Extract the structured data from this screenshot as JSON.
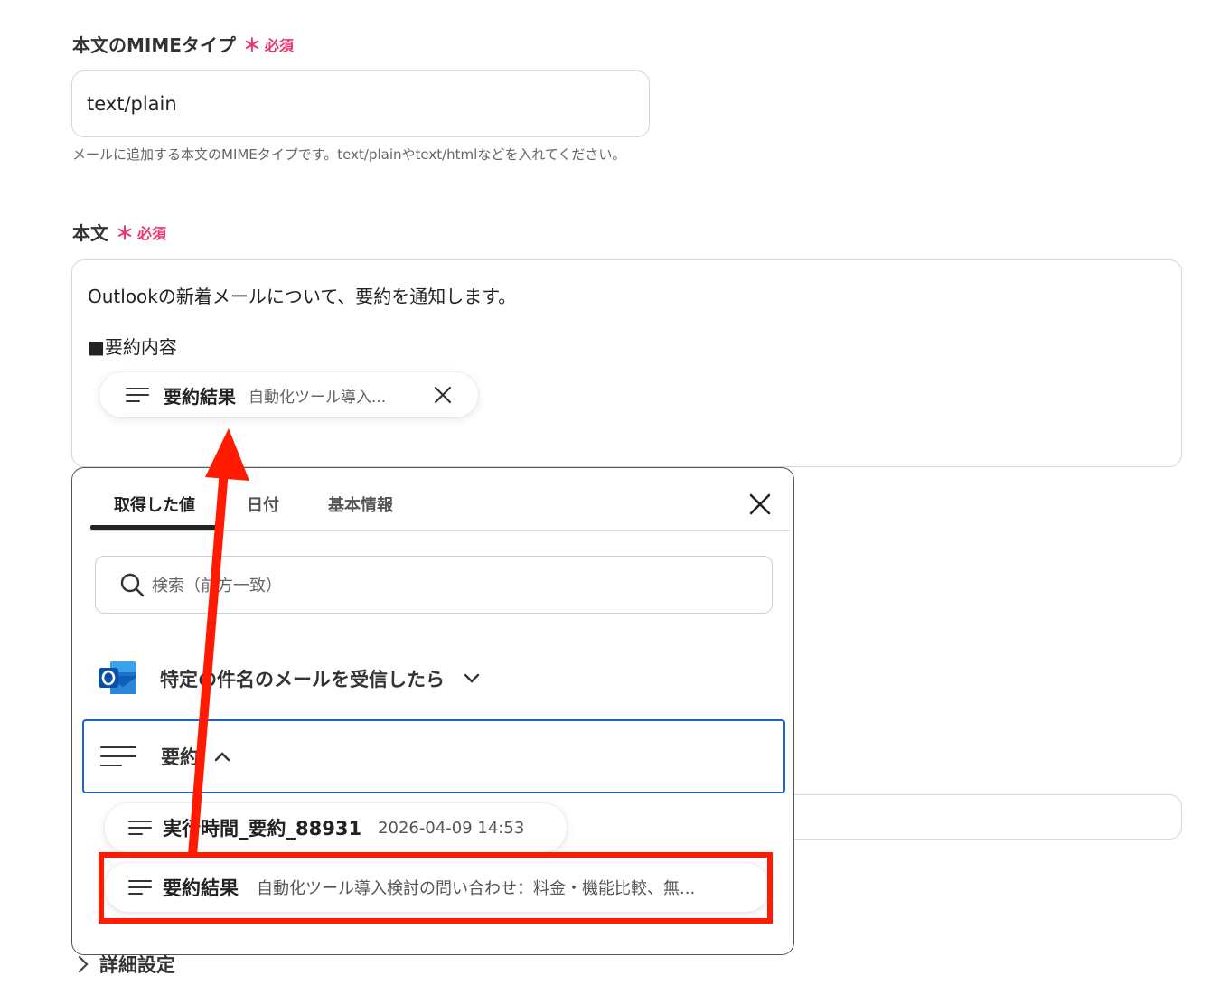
{
  "mime_field": {
    "label": "本文のMIMEタイプ",
    "required_star": "＊",
    "required_text": "必須",
    "value": "text/plain",
    "helper": "メールに追加する本文のMIMEタイプです。text/plainやtext/htmlなどを入れてください。"
  },
  "body_field": {
    "label": "本文",
    "required_star": "＊",
    "required_text": "必須",
    "line1": "Outlookの新着メールについて、要約を通知します。",
    "line2": "■要約内容",
    "chip": {
      "name": "要約結果",
      "value": "自動化ツール導入..."
    }
  },
  "popover": {
    "tabs": [
      "取得した値",
      "日付",
      "基本情報"
    ],
    "active_tab": "取得した値",
    "search_placeholder": "検索（前方一致）",
    "groups": [
      {
        "title": "特定の件名のメールを受信したら",
        "icon": "outlook-icon",
        "expanded": false
      },
      {
        "title": "要約",
        "icon": "lines-icon",
        "expanded": true
      }
    ],
    "items": [
      {
        "name": "実行時間_要約_88931",
        "value": "2026-04-09 14:53"
      },
      {
        "name": "要約結果",
        "value": "自動化ツール導入検討の問い合わせ：料金・機能比較、無..."
      }
    ]
  },
  "details": {
    "label": "詳細設定"
  },
  "annotations": {
    "arrow_color": "#ff1a00",
    "highlight_color": "#ff1a00"
  }
}
